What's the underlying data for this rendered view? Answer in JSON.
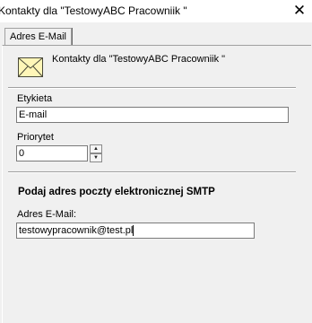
{
  "window": {
    "title": "Kontakty dla \"TestowyABC Pracowniik \""
  },
  "tabs": [
    {
      "label": "Adres E-Mail"
    }
  ],
  "header": {
    "label": "Kontakty dla \"TestowyABC Pracowniik \"",
    "icon": "envelope-icon"
  },
  "fields": {
    "etykieta": {
      "label": "Etykieta",
      "value": "E-mail"
    },
    "priorytet": {
      "label": "Priorytet",
      "value": "0"
    }
  },
  "smtp": {
    "heading": "Podaj adres poczty elektronicznej SMTP",
    "address_label": "Adres E-Mail:",
    "address_value": "testowypracownik@test.pl"
  }
}
